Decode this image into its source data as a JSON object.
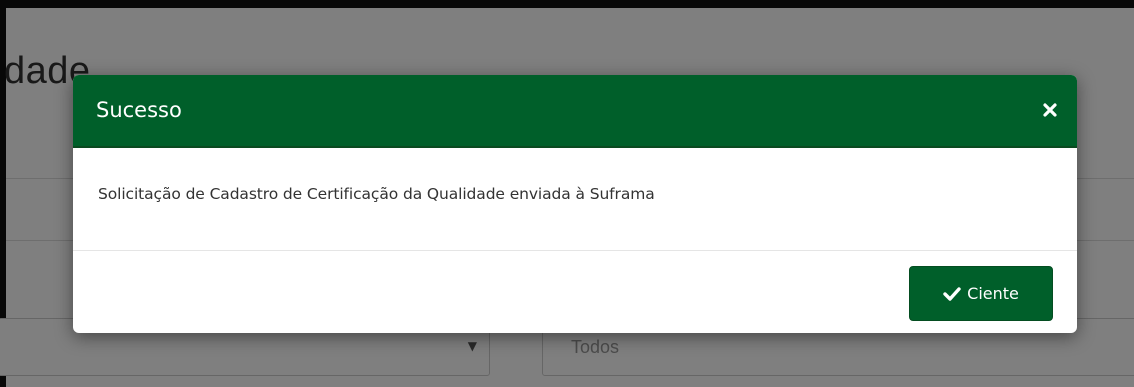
{
  "background": {
    "heading_partial": "dade",
    "filter_input_placeholder": "Todos"
  },
  "modal": {
    "title": "Sucesso",
    "message": "Solicitação de Cadastro de Certificação da Qualidade enviada à Suframa",
    "confirm_label": "Ciente",
    "header_color": "#005f2a"
  },
  "icons": {
    "close": "close-icon",
    "confirm": "check-icon",
    "select_caret": "caret-down-icon"
  }
}
